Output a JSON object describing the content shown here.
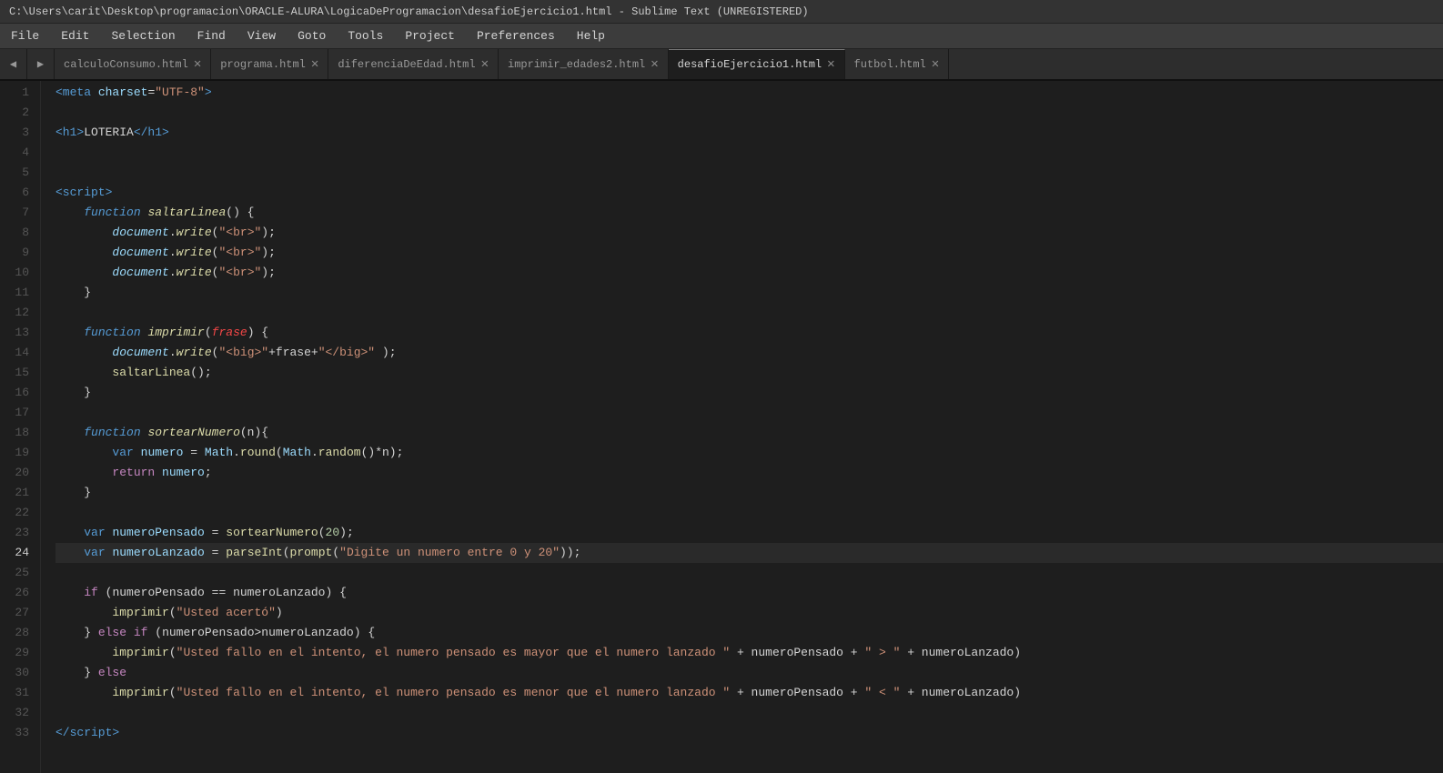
{
  "titlebar": {
    "text": "C:\\Users\\carit\\Desktop\\programacion\\ORACLE-ALURA\\LogicaDeProgramacion\\desafioEjercicio1.html - Sublime Text (UNREGISTERED)"
  },
  "menubar": {
    "items": [
      "File",
      "Edit",
      "Selection",
      "Find",
      "View",
      "Goto",
      "Tools",
      "Project",
      "Preferences",
      "Help"
    ]
  },
  "tabs": [
    {
      "label": "calculoConsumo.html",
      "active": false
    },
    {
      "label": "programa.html",
      "active": false
    },
    {
      "label": "diferenciaDeEdad.html",
      "active": false
    },
    {
      "label": "imprimir_edades2.html",
      "active": false
    },
    {
      "label": "desafioEjercicio1.html",
      "active": true
    },
    {
      "label": "futbol.html",
      "active": false
    }
  ],
  "lines": [
    1,
    2,
    3,
    4,
    5,
    6,
    7,
    8,
    9,
    10,
    11,
    12,
    13,
    14,
    15,
    16,
    17,
    18,
    19,
    20,
    21,
    22,
    23,
    24,
    25,
    26,
    27,
    28,
    29,
    30,
    31,
    32,
    33
  ]
}
